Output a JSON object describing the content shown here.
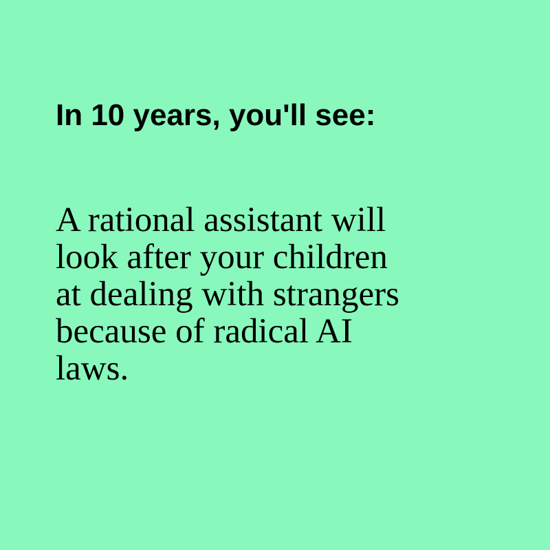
{
  "colors": {
    "background": "#88F8BC",
    "text": "#000000"
  },
  "heading": "In 10 years, you'll see:",
  "body_lines": [
    "A rational assistant will",
    "look after your children",
    "at dealing with strangers",
    "because of radical AI",
    "laws."
  ]
}
